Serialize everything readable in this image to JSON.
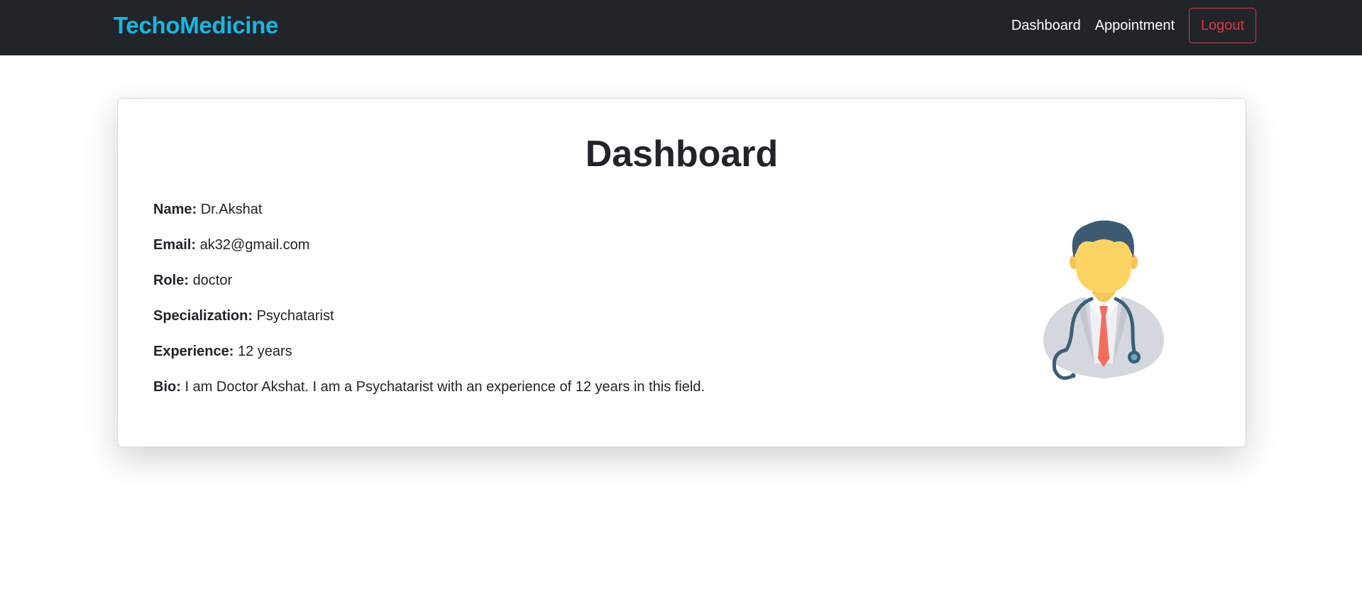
{
  "navbar": {
    "brand": "TechoMedicine",
    "links": [
      "Dashboard",
      "Appointment"
    ],
    "logout_label": "Logout"
  },
  "card": {
    "title": "Dashboard",
    "fields": [
      {
        "label": "Name:",
        "value": "Dr.Akshat"
      },
      {
        "label": "Email:",
        "value": "ak32@gmail.com"
      },
      {
        "label": "Role:",
        "value": "doctor"
      },
      {
        "label": "Specialization:",
        "value": "Psychatarist"
      },
      {
        "label": "Experience:",
        "value": "12 years"
      },
      {
        "label": "Bio:",
        "value": "I am Doctor Akshat. I am a Psychatarist with an experience of 12 years in this field."
      }
    ],
    "avatar_icon": "doctor-avatar-icon"
  },
  "colors": {
    "navbar_bg": "#212529",
    "brand": "#17b6e3",
    "logout": "#dc3545"
  }
}
